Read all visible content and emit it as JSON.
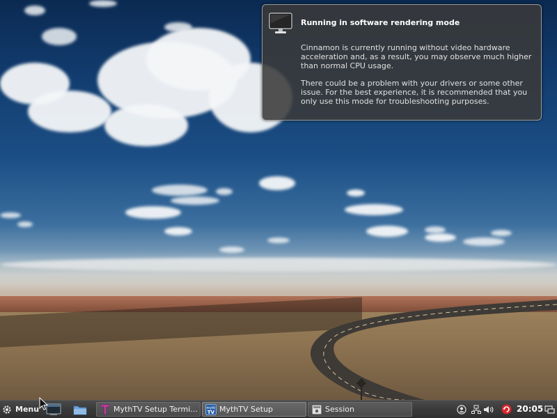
{
  "notification": {
    "title": "Running in software rendering mode",
    "body_1": "Cinnamon is currently running without video hardware acceleration and, as a result, you may observe much higher than normal CPU usage.",
    "body_2": "There could be a problem with your drivers or some other issue.  For the best experience, it is recommended that you only use this mode for troubleshooting purposes.",
    "icon": "monitor-icon"
  },
  "panel": {
    "menu_label": "Menu",
    "launchers": [
      {
        "icon": "terminal-icon"
      },
      {
        "icon": "folder-icon"
      }
    ],
    "windows": [
      {
        "label": "MythTV Setup Termi...",
        "icon": "mythtv-terminal-icon"
      },
      {
        "label": "MythTV Setup",
        "icon": "mythtv-icon",
        "active": true
      },
      {
        "label": "Session",
        "icon": "session-icon"
      }
    ],
    "tray": {
      "icons": [
        "user-icon",
        "network-icon",
        "volume-icon",
        "update-icon",
        "show-desktop-icon"
      ],
      "clock": "20:05"
    }
  },
  "colors": {
    "panel_bg": "#3a3a3a",
    "notification_bg": "#3a3a3a",
    "update_icon": "#d9262b"
  }
}
